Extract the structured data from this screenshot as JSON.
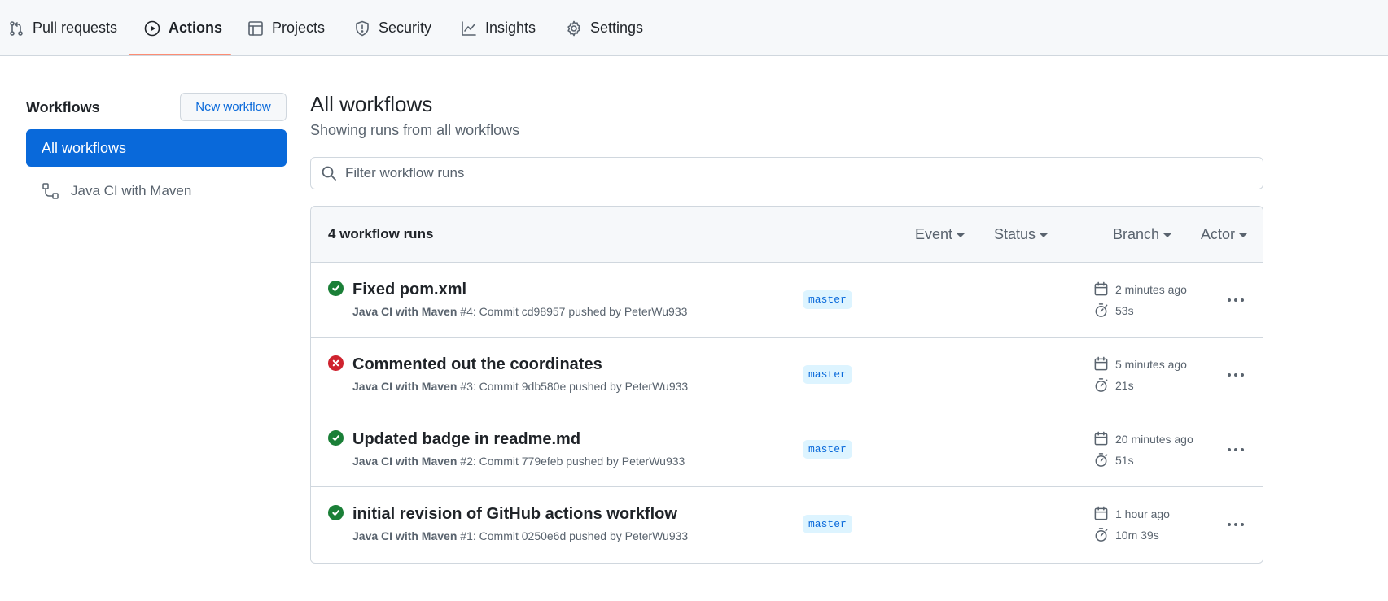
{
  "nav": {
    "tabs": [
      {
        "label": "Pull requests",
        "icon": "pull-request-icon"
      },
      {
        "label": "Actions",
        "icon": "play-icon",
        "active": true
      },
      {
        "label": "Projects",
        "icon": "table-icon"
      },
      {
        "label": "Security",
        "icon": "shield-icon"
      },
      {
        "label": "Insights",
        "icon": "graph-icon"
      },
      {
        "label": "Settings",
        "icon": "gear-icon"
      }
    ]
  },
  "sidebar": {
    "heading": "Workflows",
    "new_workflow_label": "New workflow",
    "items": [
      {
        "label": "All workflows",
        "selected": true
      },
      {
        "label": "Java CI with Maven",
        "icon": "workflow-icon"
      }
    ]
  },
  "main": {
    "title": "All workflows",
    "subtitle": "Showing runs from all workflows",
    "filter_placeholder": "Filter workflow runs",
    "runs_count": "4 workflow runs",
    "filters": [
      "Event",
      "Status",
      "Branch",
      "Actor"
    ],
    "runs": [
      {
        "status": "success",
        "title": "Fixed pom.xml",
        "workflow": "Java CI with Maven",
        "run_ref": "#4: Commit cd98957 pushed by PeterWu933",
        "branch": "master",
        "time_ago": "2 minutes ago",
        "duration": "53s"
      },
      {
        "status": "failure",
        "title": "Commented out the coordinates",
        "workflow": "Java CI with Maven",
        "run_ref": "#3: Commit 9db580e pushed by PeterWu933",
        "branch": "master",
        "time_ago": "5 minutes ago",
        "duration": "21s"
      },
      {
        "status": "success",
        "title": "Updated badge in readme.md",
        "workflow": "Java CI with Maven",
        "run_ref": "#2: Commit 779efeb pushed by PeterWu933",
        "branch": "master",
        "time_ago": "20 minutes ago",
        "duration": "51s"
      },
      {
        "status": "success",
        "title": "initial revision of GitHub actions workflow",
        "workflow": "Java CI with Maven",
        "run_ref": "#1: Commit 0250e6d pushed by PeterWu933",
        "branch": "master",
        "time_ago": "1 hour ago",
        "duration": "10m 39s"
      }
    ]
  },
  "colors": {
    "accent": "#0969da",
    "success": "#1a7f37",
    "failure": "#cf222e",
    "tab_underline": "#fd8c73"
  }
}
